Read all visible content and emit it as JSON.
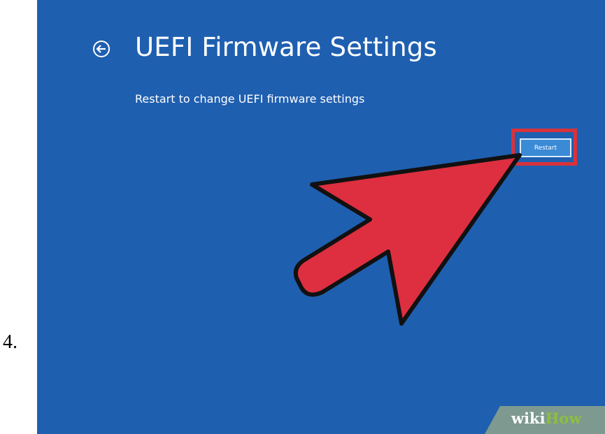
{
  "step": {
    "number": "4."
  },
  "window": {
    "back_icon": "back-arrow-circle-icon",
    "title": "UEFI Firmware Settings",
    "subtitle": "Restart to change UEFI firmware settings"
  },
  "actions": {
    "restart_label": "Restart"
  },
  "annotation": {
    "highlight_color": "#d8323b",
    "arrow_color": "#dd2f3f",
    "arrow_icon": "pointer-arrow"
  },
  "colors": {
    "screen_bg": "#1f5fb0",
    "text": "#ffffff"
  },
  "watermark": {
    "part1": "wiki",
    "part2": "How"
  }
}
